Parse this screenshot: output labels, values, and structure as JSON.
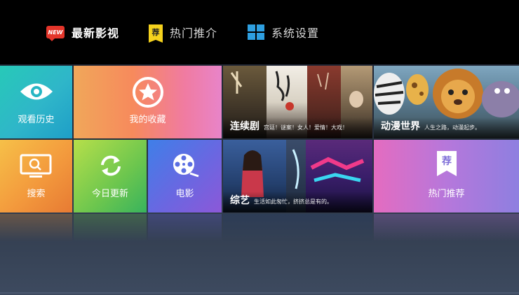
{
  "nav": {
    "items": [
      {
        "label": "最新影视",
        "badge": "NEW",
        "icon": "new-badge-icon",
        "active": true
      },
      {
        "label": "热门推介",
        "badge": "荐",
        "icon": "recommend-badge-icon",
        "active": false
      },
      {
        "label": "系统设置",
        "icon": "windows-icon",
        "active": false
      }
    ]
  },
  "tiles": {
    "history": {
      "label": "观看历史",
      "icon": "eye-icon"
    },
    "favorites": {
      "label": "我的收藏",
      "icon": "star-icon"
    },
    "search": {
      "label": "搜索",
      "icon": "tv-search-icon"
    },
    "today": {
      "label": "今日更新",
      "icon": "refresh-icon"
    },
    "movie": {
      "label": "电影",
      "icon": "film-reel-icon"
    },
    "drama": {
      "title": "连续剧",
      "subtitle": "宫廷！谜案！女人！爱情！大戏！"
    },
    "anime": {
      "title": "动漫世界",
      "subtitle": "人生之路，动漫起步。"
    },
    "variety": {
      "title": "综艺",
      "subtitle": "生活如此匆忙，挤挤总是有的。"
    },
    "hot": {
      "label": "热门推荐",
      "badge": "荐",
      "icon": "recommend-flag-icon"
    }
  },
  "colors": {
    "accent_red": "#e4352a",
    "accent_yellow": "#f5d21d",
    "accent_blue": "#2e9fe0"
  }
}
